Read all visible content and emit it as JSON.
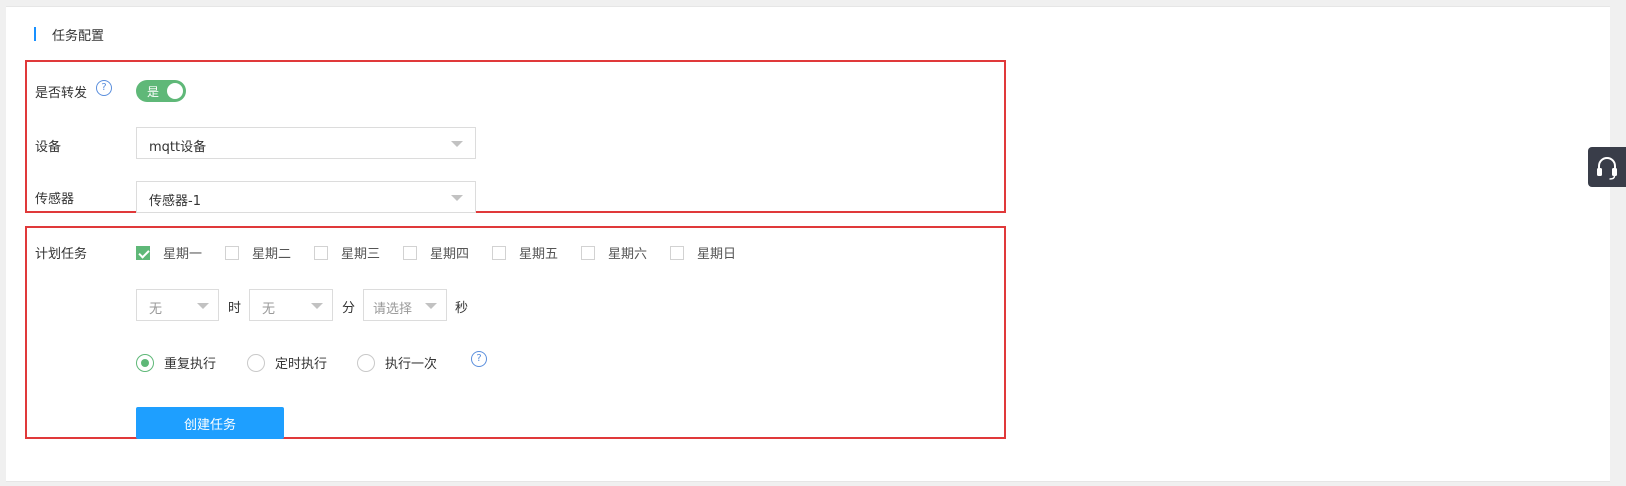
{
  "section": {
    "title": "任务配置"
  },
  "forward": {
    "label": "是否转发",
    "help_icon": "?",
    "toggle_text": "是",
    "toggle_on": true
  },
  "device": {
    "label": "设备",
    "value": "mqtt设备"
  },
  "sensor": {
    "label": "传感器",
    "value": "传感器-1"
  },
  "schedule": {
    "label": "计划任务",
    "weekdays": [
      {
        "label": "星期一",
        "checked": true
      },
      {
        "label": "星期二",
        "checked": false
      },
      {
        "label": "星期三",
        "checked": false
      },
      {
        "label": "星期四",
        "checked": false
      },
      {
        "label": "星期五",
        "checked": false
      },
      {
        "label": "星期六",
        "checked": false
      },
      {
        "label": "星期日",
        "checked": false
      }
    ],
    "hour": {
      "value": "无",
      "unit": "时"
    },
    "minute": {
      "value": "无",
      "unit": "分"
    },
    "second": {
      "value": "请选择",
      "unit": "秒"
    },
    "modes": [
      {
        "label": "重复执行",
        "checked": true
      },
      {
        "label": "定时执行",
        "checked": false
      },
      {
        "label": "执行一次",
        "checked": false
      }
    ],
    "help_icon": "?",
    "create_button": "创建任务"
  },
  "colors": {
    "accent": "#1e9fff",
    "success": "#5fb878",
    "highlight_border": "#e0393a"
  },
  "icons": {
    "floating": "headset-icon"
  }
}
